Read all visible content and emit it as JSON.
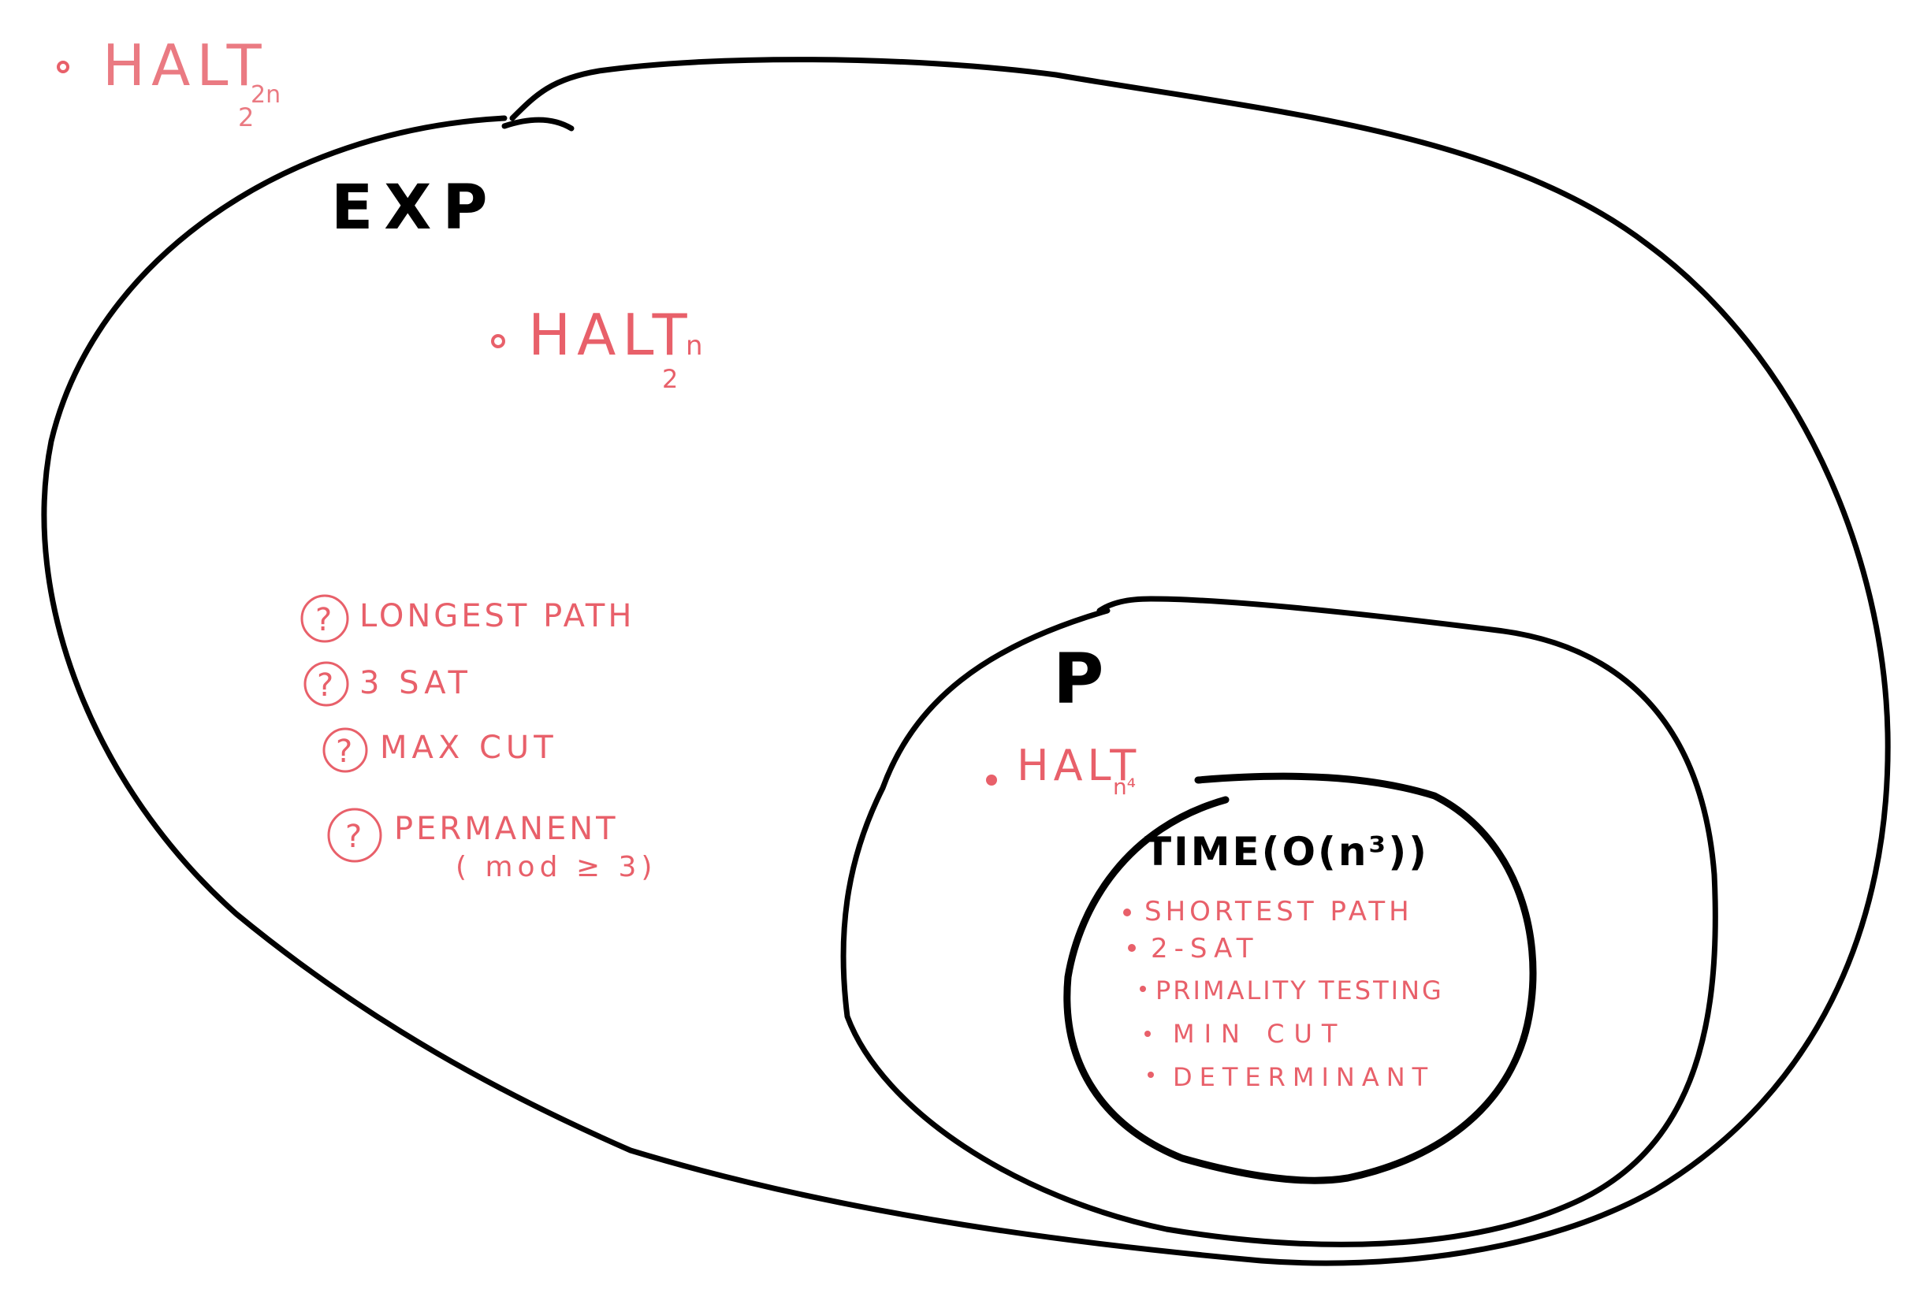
{
  "colors": {
    "outline": "#000000",
    "annotation": "#e8606a",
    "background": "#ffffff"
  },
  "sets": {
    "exp": {
      "label": "EXP"
    },
    "p": {
      "label": "P"
    },
    "time": {
      "label": "TIME(O(n³))"
    }
  },
  "outside": {
    "halt": {
      "base": "HALT",
      "sub": "2",
      "sup": "2n"
    }
  },
  "exp_region": {
    "halt": {
      "base": "HALT",
      "sub": "2",
      "sup": "n"
    },
    "unknown_marker": "?",
    "unknown_problems": [
      {
        "label": "LONGEST PATH"
      },
      {
        "label": "3 SAT"
      },
      {
        "label": "MAX CUT"
      },
      {
        "label": "PERMANENT",
        "note": "( mod ≥ 3)"
      }
    ]
  },
  "p_region": {
    "halt": {
      "base": "HALT",
      "sub": "n⁴"
    }
  },
  "time_region": {
    "problems": [
      "SHORTEST PATH",
      "2-SAT",
      "PRIMALITY TESTING",
      "MIN CUT",
      "DETERMINANT"
    ]
  }
}
